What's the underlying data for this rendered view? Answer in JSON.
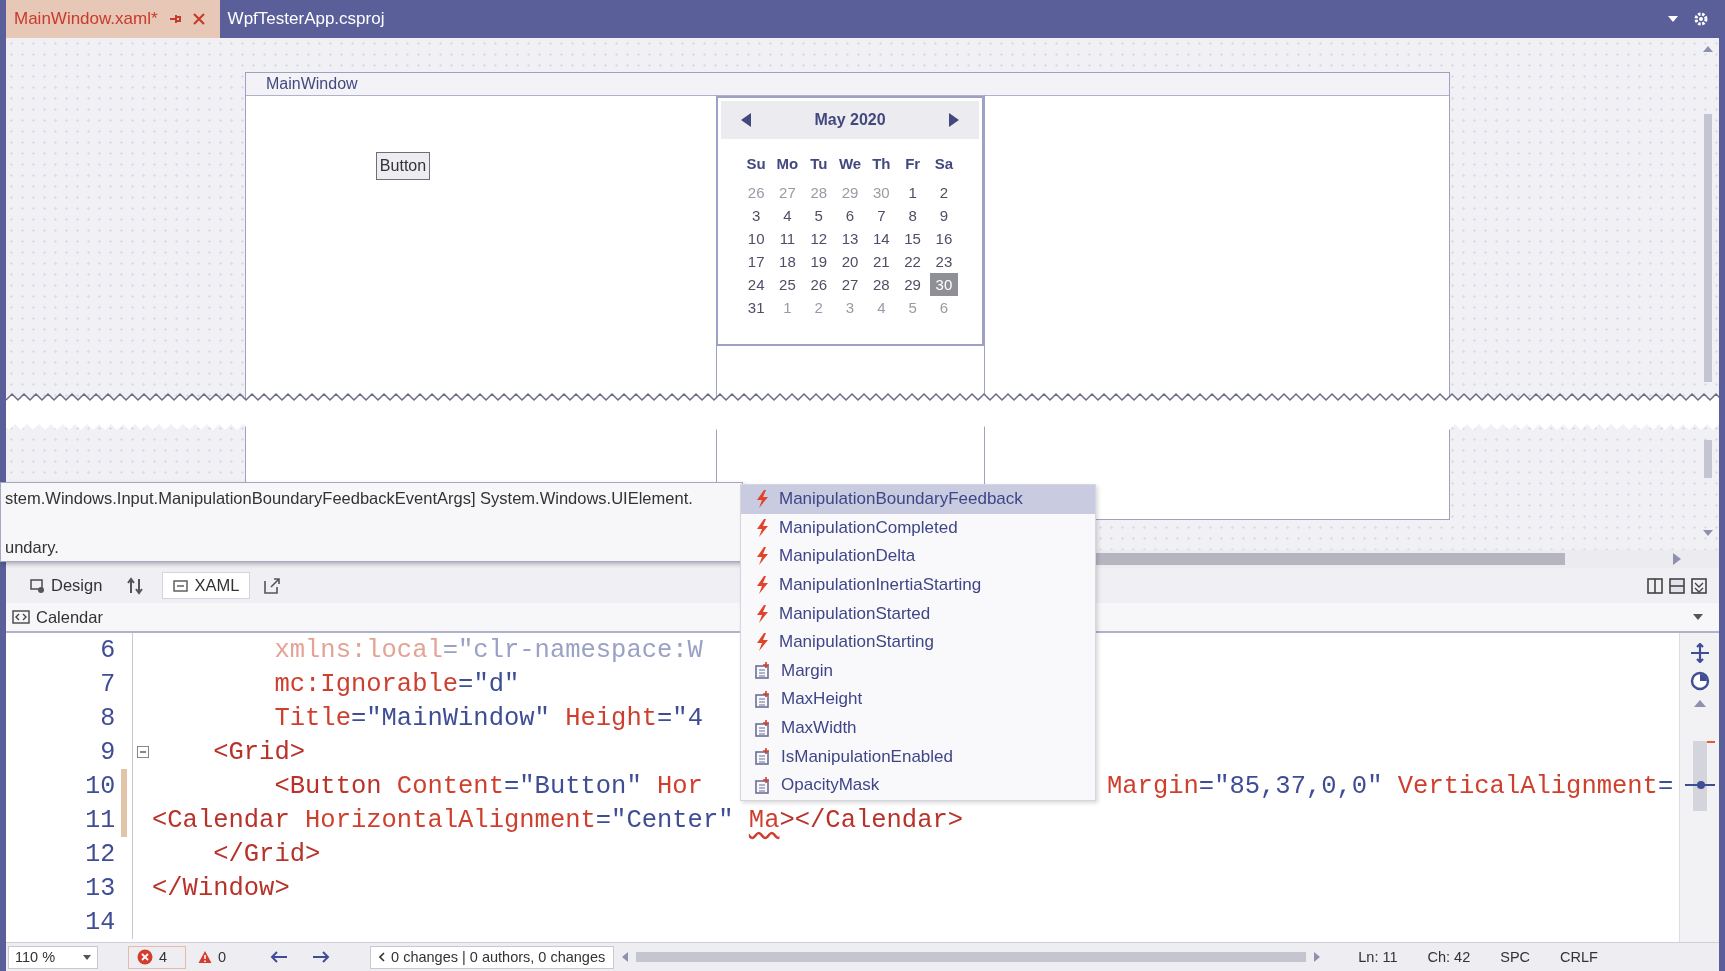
{
  "tabs": [
    {
      "label": "MainWindow.xaml*",
      "selected": true
    },
    {
      "label": "WpfTesterApp.csproj",
      "selected": false
    }
  ],
  "designer": {
    "window_title": "MainWindow",
    "button_label": "Button",
    "calendar": {
      "title": "May 2020",
      "day_names": [
        "Su",
        "Mo",
        "Tu",
        "We",
        "Th",
        "Fr",
        "Sa"
      ],
      "weeks": [
        [
          {
            "day": "26",
            "in_month": false,
            "selected": false
          },
          {
            "day": "27",
            "in_month": false,
            "selected": false
          },
          {
            "day": "28",
            "in_month": false,
            "selected": false
          },
          {
            "day": "29",
            "in_month": false,
            "selected": false
          },
          {
            "day": "30",
            "in_month": false,
            "selected": false
          },
          {
            "day": "1",
            "in_month": true,
            "selected": false
          },
          {
            "day": "2",
            "in_month": true,
            "selected": false
          }
        ],
        [
          {
            "day": "3",
            "in_month": true,
            "selected": false
          },
          {
            "day": "4",
            "in_month": true,
            "selected": false
          },
          {
            "day": "5",
            "in_month": true,
            "selected": false
          },
          {
            "day": "6",
            "in_month": true,
            "selected": false
          },
          {
            "day": "7",
            "in_month": true,
            "selected": false
          },
          {
            "day": "8",
            "in_month": true,
            "selected": false
          },
          {
            "day": "9",
            "in_month": true,
            "selected": false
          }
        ],
        [
          {
            "day": "10",
            "in_month": true,
            "selected": false
          },
          {
            "day": "11",
            "in_month": true,
            "selected": false
          },
          {
            "day": "12",
            "in_month": true,
            "selected": false
          },
          {
            "day": "13",
            "in_month": true,
            "selected": false
          },
          {
            "day": "14",
            "in_month": true,
            "selected": false
          },
          {
            "day": "15",
            "in_month": true,
            "selected": false
          },
          {
            "day": "16",
            "in_month": true,
            "selected": false
          }
        ],
        [
          {
            "day": "17",
            "in_month": true,
            "selected": false
          },
          {
            "day": "18",
            "in_month": true,
            "selected": false
          },
          {
            "day": "19",
            "in_month": true,
            "selected": false
          },
          {
            "day": "20",
            "in_month": true,
            "selected": false
          },
          {
            "day": "21",
            "in_month": true,
            "selected": false
          },
          {
            "day": "22",
            "in_month": true,
            "selected": false
          },
          {
            "day": "23",
            "in_month": true,
            "selected": false
          }
        ],
        [
          {
            "day": "24",
            "in_month": true,
            "selected": false
          },
          {
            "day": "25",
            "in_month": true,
            "selected": false
          },
          {
            "day": "26",
            "in_month": true,
            "selected": false
          },
          {
            "day": "27",
            "in_month": true,
            "selected": false
          },
          {
            "day": "28",
            "in_month": true,
            "selected": false
          },
          {
            "day": "29",
            "in_month": true,
            "selected": false
          },
          {
            "day": "30",
            "in_month": true,
            "selected": true
          }
        ],
        [
          {
            "day": "31",
            "in_month": true,
            "selected": false
          },
          {
            "day": "1",
            "in_month": false,
            "selected": false
          },
          {
            "day": "2",
            "in_month": false,
            "selected": false
          },
          {
            "day": "3",
            "in_month": false,
            "selected": false
          },
          {
            "day": "4",
            "in_month": false,
            "selected": false
          },
          {
            "day": "5",
            "in_month": false,
            "selected": false
          },
          {
            "day": "6",
            "in_month": false,
            "selected": false
          }
        ]
      ]
    }
  },
  "tooltip": {
    "lines": [
      "stem.Windows.Input.ManipulationBoundaryFeedbackEventArgs] System.Windows.UIElement.",
      "undary."
    ]
  },
  "view_tabs": [
    {
      "label": "Design",
      "selected": false
    },
    {
      "label": "XAML",
      "selected": true
    }
  ],
  "breadcrumb": "Calendar",
  "completion": {
    "items": [
      {
        "label": "ManipulationBoundaryFeedback",
        "kind": "event",
        "selected": true
      },
      {
        "label": "ManipulationCompleted",
        "kind": "event",
        "selected": false
      },
      {
        "label": "ManipulationDelta",
        "kind": "event",
        "selected": false
      },
      {
        "label": "ManipulationInertiaStarting",
        "kind": "event",
        "selected": false
      },
      {
        "label": "ManipulationStarted",
        "kind": "event",
        "selected": false
      },
      {
        "label": "ManipulationStarting",
        "kind": "event",
        "selected": false
      },
      {
        "label": "Margin",
        "kind": "property",
        "selected": false
      },
      {
        "label": "MaxHeight",
        "kind": "property",
        "selected": false
      },
      {
        "label": "MaxWidth",
        "kind": "property",
        "selected": false
      },
      {
        "label": "IsManipulationEnabled",
        "kind": "property",
        "selected": false
      },
      {
        "label": "OpacityMask",
        "kind": "property",
        "selected": false
      }
    ]
  },
  "editor": {
    "lines": [
      {
        "number": "6",
        "changed": false,
        "foldable": false,
        "faded": true,
        "tokens": [
          {
            "text": "        xmlns:local",
            "kind": "attr"
          },
          {
            "text": "=",
            "kind": "eq"
          },
          {
            "text": "\"clr-namespace:W",
            "kind": "value"
          }
        ]
      },
      {
        "number": "7",
        "changed": false,
        "foldable": false,
        "faded": false,
        "tokens": [
          {
            "text": "        mc:Ignorable",
            "kind": "attr"
          },
          {
            "text": "=",
            "kind": "eq"
          },
          {
            "text": "\"d\"",
            "kind": "value"
          }
        ]
      },
      {
        "number": "8",
        "changed": false,
        "foldable": false,
        "faded": false,
        "tokens": [
          {
            "text": "        Title",
            "kind": "attr"
          },
          {
            "text": "=",
            "kind": "eq"
          },
          {
            "text": "\"MainWindow\"",
            "kind": "value"
          },
          {
            "text": " Height",
            "kind": "attr"
          },
          {
            "text": "=",
            "kind": "eq"
          },
          {
            "text": "\"4",
            "kind": "value"
          }
        ]
      },
      {
        "number": "9",
        "changed": false,
        "foldable": true,
        "faded": false,
        "tokens": [
          {
            "text": "    <Grid>",
            "kind": "tag"
          }
        ]
      },
      {
        "number": "10",
        "changed": true,
        "foldable": false,
        "faded": false,
        "tokens": [
          {
            "text": "        <Button",
            "kind": "tag"
          },
          {
            "text": " Content",
            "kind": "attr"
          },
          {
            "text": "=",
            "kind": "eq"
          },
          {
            "text": "\"Button\"",
            "kind": "value"
          },
          {
            "text": " Hor",
            "kind": "attr"
          }
        ],
        "tokens_right": [
          {
            "text": "Margin",
            "kind": "attr"
          },
          {
            "text": "=",
            "kind": "eq"
          },
          {
            "text": "\"85,37,0,0\"",
            "kind": "value"
          },
          {
            "text": " VerticalAlignment",
            "kind": "attr"
          },
          {
            "text": "=",
            "kind": "eq"
          }
        ]
      },
      {
        "number": "11",
        "changed": true,
        "foldable": false,
        "faded": false,
        "tokens": [
          {
            "text": "<Calendar",
            "kind": "tag"
          },
          {
            "text": " HorizontalAlignment",
            "kind": "attr"
          },
          {
            "text": "=",
            "kind": "eq"
          },
          {
            "text": "\"Center\" ",
            "kind": "value"
          },
          {
            "text": "Ma",
            "kind": "attr_error"
          },
          {
            "text": "></Calendar>",
            "kind": "tag"
          }
        ]
      },
      {
        "number": "12",
        "changed": false,
        "foldable": false,
        "faded": false,
        "tokens": [
          {
            "text": "    </Grid>",
            "kind": "tag"
          }
        ]
      },
      {
        "number": "13",
        "changed": false,
        "foldable": false,
        "faded": false,
        "tokens": [
          {
            "text": "</Window>",
            "kind": "tag"
          }
        ]
      },
      {
        "number": "14",
        "changed": false,
        "foldable": false
      }
    ]
  },
  "status_bar": {
    "zoom": "110 %",
    "errors": "4",
    "warnings": "0",
    "changes": "0 changes | 0 authors, 0 changes",
    "line": "Ln: 11",
    "column": "Ch: 42",
    "indent_mode": "SPC",
    "line_ending": "CRLF"
  }
}
